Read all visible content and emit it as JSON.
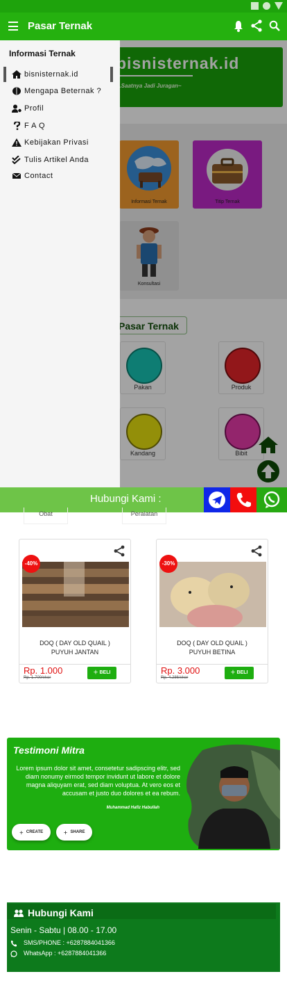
{
  "app": {
    "title": "Pasar Ternak"
  },
  "banner": {
    "title": "bisnisternak.id",
    "subtitle": "...Saatnya Jadi Juragan~"
  },
  "services": [
    {
      "label": "Informasi Ternak"
    },
    {
      "label": "Titip Ternak"
    },
    {
      "label": "Konsultasi"
    }
  ],
  "market": {
    "heading": "Pasar Ternak",
    "categories": [
      {
        "label": "Pakan"
      },
      {
        "label": "Produk"
      },
      {
        "label": "Kandang"
      },
      {
        "label": "Bibit"
      },
      {
        "label": "Obat"
      },
      {
        "label": "Peralatan"
      }
    ]
  },
  "drawer": {
    "title": "Informasi Ternak",
    "items": [
      {
        "label": "bisnisternak.id",
        "icon": "home-icon"
      },
      {
        "label": "Mengapa Beternak ?",
        "icon": "brain-icon"
      },
      {
        "label": "Profil",
        "icon": "user-cog-icon"
      },
      {
        "label": "F A Q",
        "icon": "question-icon"
      },
      {
        "label": "Kebijakan Privasi",
        "icon": "warning-icon"
      },
      {
        "label": "Tulis Artikel Anda",
        "icon": "check-double-icon"
      },
      {
        "label": "Contact",
        "icon": "envelope-icon"
      }
    ]
  },
  "contact_bar": {
    "label": "Hubungi Kami :"
  },
  "products": [
    {
      "discount": "-40%",
      "name_line1": "DOQ ( DAY OLD QUAIL )",
      "name_line2": "PUYUH JANTAN",
      "price": "Rp. 1.000",
      "old_price": "Rp. 1.700/ekor",
      "buy": "BELI"
    },
    {
      "discount": "-30%",
      "name_line1": "DOQ ( DAY OLD QUAIL )",
      "name_line2": "PUYUH BETINA",
      "price": "Rp. 3.000",
      "old_price": "Rp. 4.286/ekor",
      "buy": "BELI"
    }
  ],
  "testimoni": {
    "title": "Testimoni Mitra",
    "text": "Lorem ipsum dolor sit amet, consetetur sadipscing elitr, sed diam nonumy eirmod tempor invidunt ut labore et dolore magna aliquyam erat, sed diam voluptua. At vero eos et accusam et justo duo dolores et ea rebum.",
    "author": "Muhammad Hafiz Habullah",
    "create_label": "CREATE",
    "share_label": "SHARE"
  },
  "footer": {
    "title": "Hubungi Kami",
    "hours": "Senin - Sabtu | 08.00 - 17.00",
    "sms": "SMS/PHONE : +6287884041366",
    "whatsapp": "WhatsApp : +6287884041366"
  },
  "colors": {
    "primary": "#25b10f",
    "dark": "#0d7a1c",
    "telegram": "#0f27e8",
    "phone": "#f30d0d",
    "whatsapp": "#27a912"
  }
}
